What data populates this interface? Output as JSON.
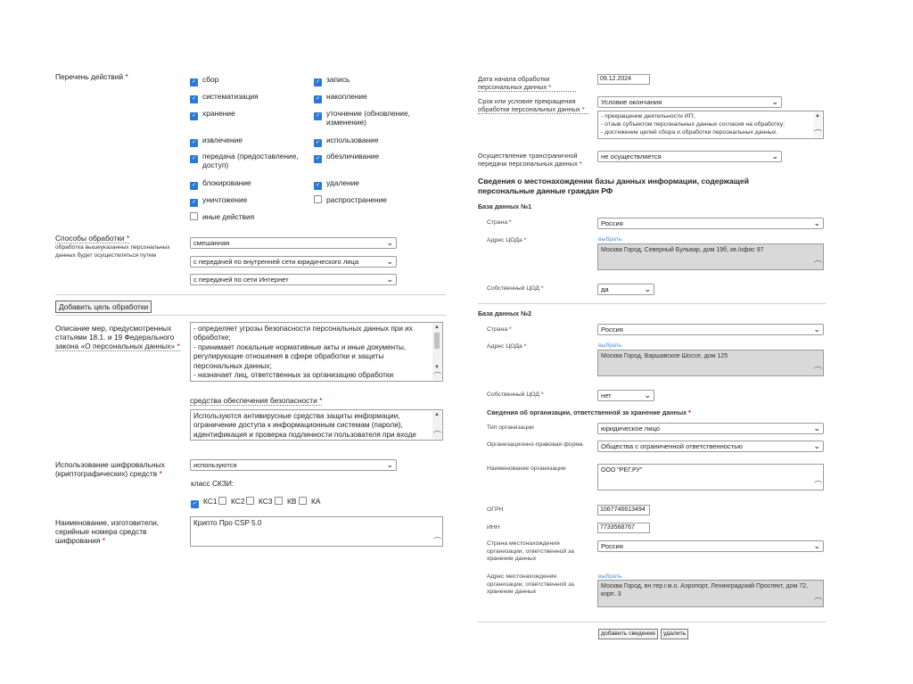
{
  "left": {
    "actions": {
      "label": "Перечень действий",
      "items": [
        {
          "label": "сбор",
          "checked": true
        },
        {
          "label": "запись",
          "checked": true
        },
        {
          "label": "систематизация",
          "checked": true
        },
        {
          "label": "накопление",
          "checked": true
        },
        {
          "label": "хранение",
          "checked": true
        },
        {
          "label": "уточнение (обновление, изменение)",
          "checked": true
        },
        {
          "label": "извлечение",
          "checked": true
        },
        {
          "label": "использование",
          "checked": true
        },
        {
          "label": "передача (предоставление, доступ)",
          "checked": true
        },
        {
          "label": "обезличивание",
          "checked": true
        },
        {
          "label": "блокирование",
          "checked": true
        },
        {
          "label": "удаление",
          "checked": true
        },
        {
          "label": "уничтожение",
          "checked": true
        },
        {
          "label": "распространение",
          "checked": false
        },
        {
          "label": "иные действия",
          "checked": false
        }
      ]
    },
    "methods": {
      "label": "Способы обработки",
      "hint": "обработка вышеуказанных персональных данных будет осуществляться путем",
      "select1": "смешанная",
      "select2": "с передачей по внутренней сети юридического лица",
      "select3": "с передачей по сети Интернет"
    },
    "add_goal_button": "Добавить цель обработки",
    "measures": {
      "label": "Описание мер, предусмотренных статьями 18.1. и 19 Федерального закона «О персональных данных»",
      "text": "- определяет угрозы безопасности персональных данных при их обработке;\n- принимает локальные нормативные акты и иные документы, регулирующие отношения в сфере обработки и защиты персональных данных;\n- назначает лиц, ответственных за организацию обработки"
    },
    "security": {
      "label": "средства обеспечения безопасности",
      "text": "Используются антивирусные средства защиты информации, ограничение доступа к информационным системам (пароли), идентификация и проверка подлинности пользователя при входе"
    },
    "crypto": {
      "label": "Использование шифровальных (криптографических) средств",
      "select": "используются",
      "class_label": "класс СКЗИ:",
      "classes": [
        {
          "label": "КС1",
          "checked": true
        },
        {
          "label": "КС2",
          "checked": false
        },
        {
          "label": "КС3",
          "checked": false
        },
        {
          "label": "КВ",
          "checked": false
        },
        {
          "label": "КА",
          "checked": false
        }
      ]
    },
    "crypto_names": {
      "label": "Наименование, изготовители, серийные номера средств шифрования",
      "text": "Крипто Про CSP 5.0"
    }
  },
  "right": {
    "start_date": {
      "label": "Дата начала обработки персональных данных",
      "value": "09.12.2024"
    },
    "term": {
      "label": "Срок или условие прекращения обработки персональных данных",
      "select": "Условие окончания",
      "text": "- прекращение деятельности ИП;\n- отзыв субъектом персональных данных согласия на обработку;\n- достижение целей сбора и обработки персональных данных."
    },
    "transborder": {
      "label": "Осуществление трансграничной передачи персональных данных",
      "select": "не осуществляется"
    },
    "db_heading": "Сведения о местонахождении базы данных информации, содержащей персональные данные граждан РФ",
    "db1": {
      "title": "База данных №1",
      "country_label": "Страна",
      "country": "Россия",
      "address_label": "Адрес ЦОДа",
      "choose": "выбрать",
      "address": "Москва Город, Северный Бульвар, дом 19б, кв./офис 97",
      "own_label": "Собственный ЦОД",
      "own": "да"
    },
    "db2": {
      "title": "База данных №2",
      "country_label": "Страна",
      "country": "Россия",
      "address_label": "Адрес ЦОДа",
      "choose": "выбрать",
      "address": "Москва Город, Варшавское Шоссе, дом 125",
      "own_label": "Собственный ЦОД",
      "own": "нет"
    },
    "org": {
      "title": "Сведения об организации, ответственной за хранение данных",
      "type_label": "Тип организации",
      "type": "юридическое лицо",
      "form_label": "Организационно-правовая форма",
      "form": "Общества с ограниченной ответственностью",
      "name_label": "Наименование организации",
      "name": "ООО \"РЕГ.РУ\"",
      "ogrn_label": "ОГРН",
      "ogrn": "1067746613494",
      "inn_label": "ИНН",
      "inn": "7733568767",
      "country_label": "Страна местонахождения организации, ответственной за хранение данных",
      "country": "Россия",
      "address_label": "Адрес местонахождения организации, ответственной за хранение данных",
      "choose": "выбрать",
      "address": "Москва Город, вн.тер.г.м.о. Аэропорт, Ленинградский Проспект, дом 72, корп. 3"
    },
    "add_button": "добавить сведения",
    "delete_button": "удалить"
  }
}
